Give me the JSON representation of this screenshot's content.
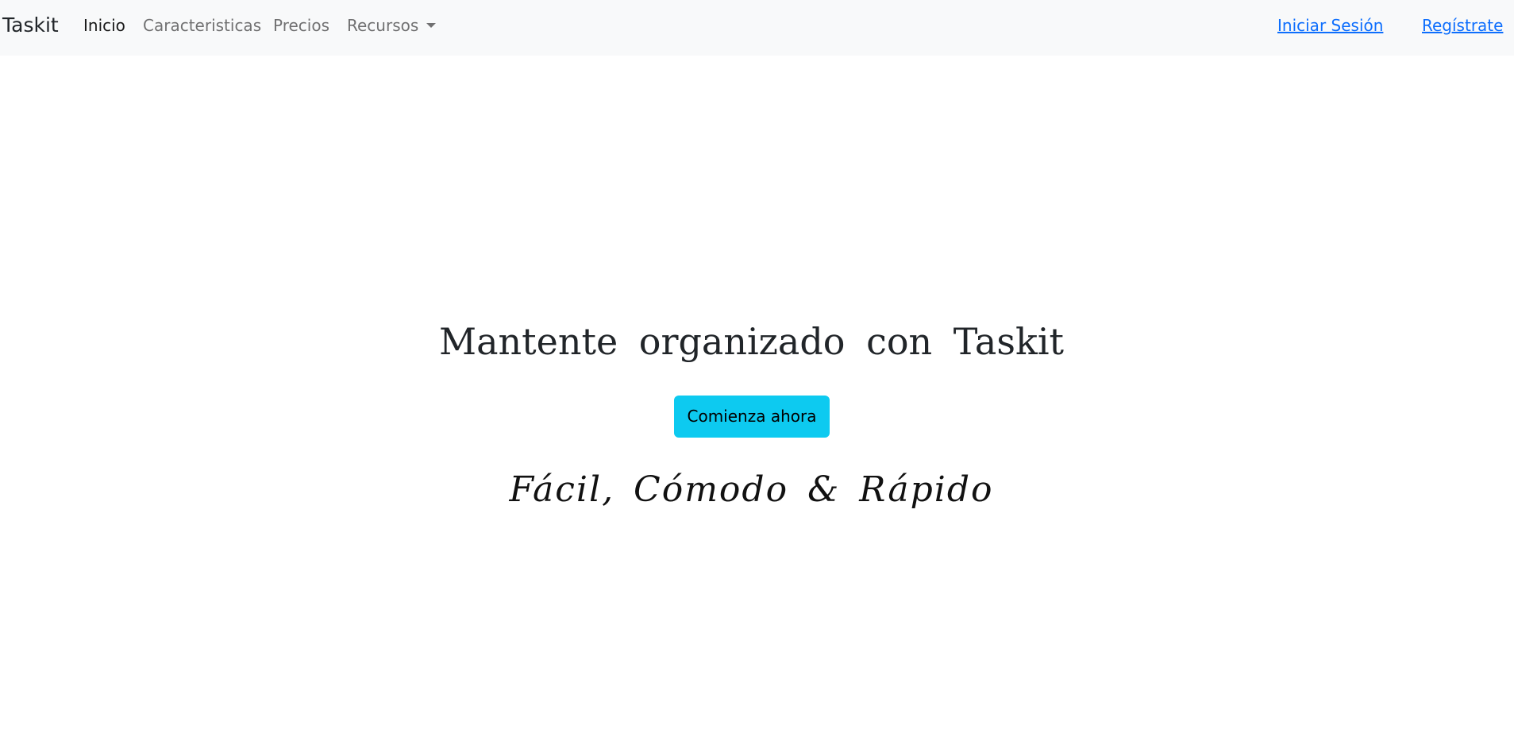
{
  "navbar": {
    "brand": "Taskit",
    "items": [
      {
        "label": "Inicio",
        "active": true
      },
      {
        "label": "Caracteristicas",
        "active": false
      },
      {
        "label": "Precios",
        "active": false
      },
      {
        "label": "Recursos",
        "active": false,
        "dropdown": true
      }
    ],
    "login_label": "Iniciar Sesión",
    "register_label": "Regístrate"
  },
  "hero": {
    "title": "Mantente organizado con Taskit",
    "cta_label": "Comienza ahora",
    "tagline": "Fácil, Cómodo & Rápido"
  },
  "colors": {
    "navbar_bg": "#f8f9fa",
    "cta_bg": "#0dcaf0",
    "link": "#0d6efd"
  }
}
